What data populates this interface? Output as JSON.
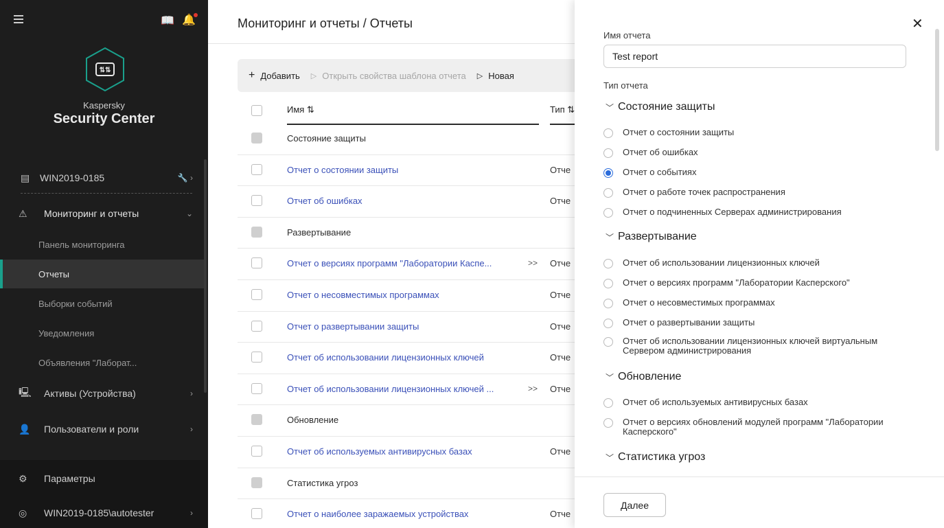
{
  "sidebar": {
    "brand_small": "Kaspersky",
    "brand_big": "Security Center",
    "server": "WIN2019-0185",
    "monitoring": "Мониторинг и отчеты",
    "sub": [
      "Панель мониторинга",
      "Отчеты",
      "Выборки событий",
      "Уведомления",
      "Объявления \"Лаборат..."
    ],
    "assets": "Активы (Устройства)",
    "users": "Пользователи и роли",
    "settings": "Параметры",
    "account": "WIN2019-0185\\autotester"
  },
  "header": {
    "breadcrumb": "Мониторинг и отчеты  /  Отчеты"
  },
  "toolbar": {
    "add": "Добавить",
    "open_props": "Открыть свойства шаблона отчета",
    "new": "Новая"
  },
  "table": {
    "col_name": "Имя ⇅",
    "col_type": "Тип ⇅",
    "rows": [
      {
        "name": "Состояние защиты",
        "type": "",
        "group": true
      },
      {
        "name": "Отчет о состоянии защиты",
        "type": "Отче"
      },
      {
        "name": "Отчет об ошибках",
        "type": "Отче"
      },
      {
        "name": "Развертывание",
        "type": "",
        "group": true
      },
      {
        "name": "Отчет о версиях программ \"Лаборатории Каспе...",
        "type": "Отче",
        "more": ">>"
      },
      {
        "name": "Отчет о несовместимых программах",
        "type": "Отче"
      },
      {
        "name": "Отчет о развертывании защиты",
        "type": "Отче"
      },
      {
        "name": "Отчет об использовании лицензионных ключей",
        "type": "Отче"
      },
      {
        "name": "Отчет об использовании лицензионных ключей ...",
        "type": "Отче",
        "more": ">>"
      },
      {
        "name": "Обновление",
        "type": "",
        "group": true
      },
      {
        "name": "Отчет об используемых антивирусных базах",
        "type": "Отче"
      },
      {
        "name": "Статистика угроз",
        "type": "",
        "group": true
      },
      {
        "name": "Отчет о наиболее заражаемых устройствах",
        "type": "Отче"
      }
    ]
  },
  "panel": {
    "name_label": "Имя отчета",
    "name_value": "Test report",
    "type_label": "Тип отчета",
    "categories": [
      {
        "title": "Состояние защиты",
        "options": [
          "Отчет о состоянии защиты",
          "Отчет об ошибках",
          "Отчет о событиях",
          "Отчет о работе точек распространения",
          "Отчет о подчиненных Серверах администрирования"
        ]
      },
      {
        "title": "Развертывание",
        "options": [
          "Отчет об использовании лицензионных ключей",
          "Отчет о версиях программ \"Лаборатории Касперского\"",
          "Отчет о несовместимых программах",
          "Отчет о развертывании защиты",
          "Отчет об использовании лицензионных ключей виртуальным Сервером администрирования"
        ]
      },
      {
        "title": "Обновление",
        "options": [
          "Отчет об используемых антивирусных базах",
          "Отчет о версиях обновлений модулей программ \"Лаборатории Касперского\""
        ]
      },
      {
        "title": "Статистика угроз",
        "options": []
      }
    ],
    "selected": "Отчет о событиях",
    "next_label": "Далее",
    "accent": "#2b6cdb"
  }
}
